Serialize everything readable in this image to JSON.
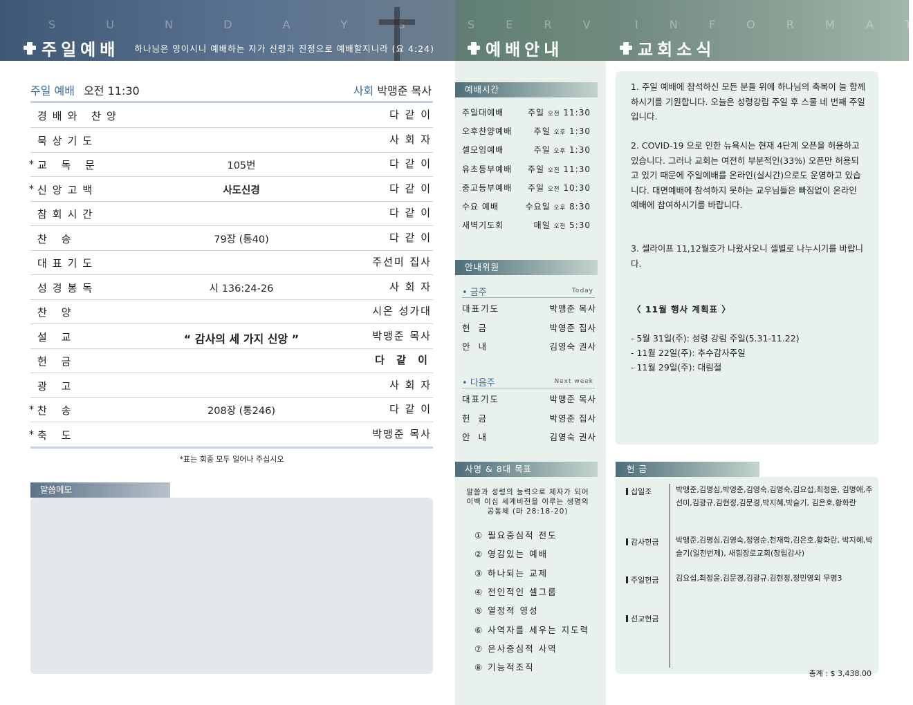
{
  "header": {
    "left_letters": "S U N D A Y   S E R V I C E",
    "left_title": "주일예배",
    "left_verse": "하나님은 영이시니 예배하는 자가 신령과 진정으로 예배할지니라 (요 4:24)",
    "mid_letters": "S E R V I C E",
    "mid_title": "예배안내",
    "right_letters": "I N F O R M A T I O N",
    "right_title": "교회소식"
  },
  "service": {
    "label": "주일 예배",
    "time": "오전 11:30",
    "host_label": "사회",
    "host_name": "박맹준 목사",
    "rows": [
      {
        "star": "",
        "name": "경배와 찬양",
        "mid": "",
        "who": "다 같 이"
      },
      {
        "star": "",
        "name": "묵상기도",
        "mid": "",
        "who": "사 회 자"
      },
      {
        "star": "*",
        "name": "교 독 문",
        "mid": "105번",
        "who": "다 같 이"
      },
      {
        "star": "*",
        "name": "신앙고백",
        "mid": "사도신경",
        "who": "다 같 이"
      },
      {
        "star": "",
        "name": "참회시간",
        "mid": "",
        "who": "다 같 이"
      },
      {
        "star": "",
        "name": "찬     송",
        "mid": "79장 (통40)",
        "who": "다 같 이"
      },
      {
        "star": "",
        "name": "대표기도",
        "mid": "",
        "who": "주선미 집사"
      },
      {
        "star": "",
        "name": "성경봉독",
        "mid": "시 136:24-26",
        "who": "사 회 자"
      },
      {
        "star": "",
        "name": "찬     양",
        "mid": "",
        "who": "시온 성가대"
      },
      {
        "star": "",
        "name": "설     교",
        "mid": "“ 감사의 세 가지 신앙 ”",
        "who": "박맹준 목사"
      },
      {
        "star": "",
        "name": "헌     금",
        "mid": "",
        "who": "다 같 이"
      },
      {
        "star": "",
        "name": "광     고",
        "mid": "",
        "who": "사 회 자"
      },
      {
        "star": "*",
        "name": "찬     송",
        "mid": "208장 (통246)",
        "who": "다 같 이"
      },
      {
        "star": "*",
        "name": "축     도",
        "mid": "",
        "who": "박맹준 목사"
      }
    ],
    "note": "*표는 회중 모두 일어나 주십시오"
  },
  "memo": {
    "title": "말씀메모"
  },
  "worship_times": {
    "title": "예배시간",
    "rows": [
      {
        "name": "주일대예배",
        "day": "주일",
        "ampm": "오전",
        "time": "11:30"
      },
      {
        "name": "오후찬양예배",
        "day": "주일",
        "ampm": "오후",
        "time": "1:30"
      },
      {
        "name": "셀모임예배",
        "day": "주일",
        "ampm": "오후",
        "time": "1:30"
      },
      {
        "name": "유초등부예배",
        "day": "주일",
        "ampm": "오전",
        "time": "11:30"
      },
      {
        "name": "중고등부예배",
        "day": "주일",
        "ampm": "오전",
        "time": "10:30"
      },
      {
        "name": "수요 예배",
        "day": "수요일",
        "ampm": "오후",
        "time": "8:30"
      },
      {
        "name": "새벽기도회",
        "day": "매일",
        "ampm": "오전",
        "time": "5:30"
      }
    ]
  },
  "greeters": {
    "title": "안내위원",
    "this_week": {
      "label": "금주",
      "label_en": "Today",
      "rows": [
        {
          "role": "대표기도",
          "name": "박맹준 목사"
        },
        {
          "role": "헌금",
          "name": "박영준 집사"
        },
        {
          "role": "안내",
          "name": "김영숙 권사"
        }
      ]
    },
    "next_week": {
      "label": "다음주",
      "label_en": "Next week",
      "rows": [
        {
          "role": "대표기도",
          "name": "박맹준 목사"
        },
        {
          "role": "헌금",
          "name": "박영준 집사"
        },
        {
          "role": "안내",
          "name": "김영숙 권사"
        }
      ]
    }
  },
  "mission": {
    "title": "사명 & 8대 목표",
    "intro": "말씀과 성령의 능력으로 제자가 되어 이백 이십 세계비전을 이루는 생명의 공동체 (마 28:18-20)",
    "goals": [
      "① 필요중심적 전도",
      "② 영감있는 예배",
      "③ 하나되는 교제",
      "④ 전인적인 셀그룹",
      "⑤ 열정적 영성",
      "⑥ 사역자를 세우는 지도력",
      "⑦ 은사중심적 사역",
      "⑧ 기능적조직"
    ]
  },
  "news": {
    "p1": "1. 주일 예배에 참석하신 모든 분들 위에 하나님의 축복이 늘 함께 하시기를 기원합니다. 오늘은 성령강림 주일 후 스물 네 번째 주일입니다.",
    "p2": "2. COVID-19 으로 인한 뉴욕시는 현재 4단계 오픈을 허용하고 있습니다. 그러나 교회는 여전히 부분적인(33%) 오픈만 허용되고 있기 때문에 주일예배를 온라인(실시간)으로도 운영하고 있습니다. 대면예배에 참석하지 못하는 교우님들은 빠짐없이 온라인 예배에 참여하시기를 바랍니다.",
    "p3": "3. 셀라이프 11,12월호가 나왔사오니 셀별로 나누시기를 바랍니다.",
    "events_title": "〈 11월 행사 계획표 〉",
    "events": [
      "- 5월 31일(주): 성령 강림 주일(5.31-11.22)",
      "- 11월 22일(주): 추수감사주일",
      "- 11월 29일(주): 대림절"
    ]
  },
  "offering": {
    "title": "헌금",
    "categories": [
      {
        "label": "십일조",
        "names": "박맹준,김명심,박영준,김영숙,김명숙,김요섭,최정윤, 김명애,주선미,김광규,김현정,김문경,박지혜,박슬기, 김은호,황화란"
      },
      {
        "label": "감사헌금",
        "names": "박맹준,김명심,김영숙,정영순,천재학,김은호,황화란, 박지혜,박슬기(일천번제), 새힘장로교회(창립감사)"
      },
      {
        "label": "주일헌금",
        "names": "김요섭,최정윤,김문경,김광규,김현정,정민영외 무명3"
      },
      {
        "label": "선교헌금",
        "names": ""
      }
    ],
    "total_label": "총계 :",
    "total": "$ 3,438.00"
  }
}
